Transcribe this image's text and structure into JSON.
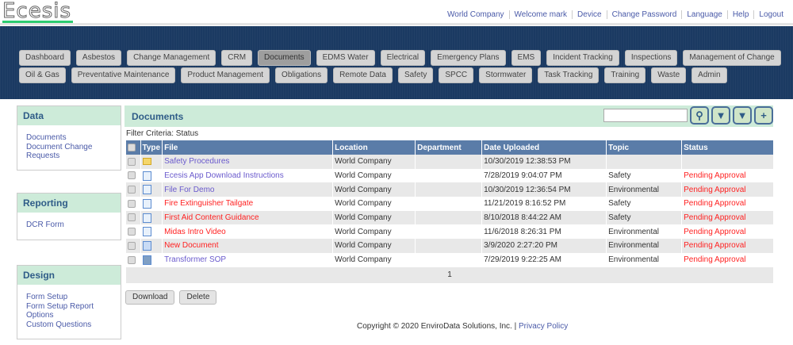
{
  "logo": "Ecesis",
  "top_links": [
    "World Company",
    "Welcome mark",
    "Device",
    "Change Password",
    "Language",
    "Help",
    "Logout"
  ],
  "nav_row1": [
    "Dashboard",
    "Asbestos",
    "Change Management",
    "CRM",
    "Documents",
    "EDMS Water",
    "Electrical",
    "Emergency Plans",
    "EMS",
    "Incident Tracking",
    "Inspections",
    "Management of Change"
  ],
  "nav_row2": [
    "Oil & Gas",
    "Preventative Maintenance",
    "Product Management",
    "Obligations",
    "Remote Data",
    "Safety",
    "SPCC",
    "Stormwater",
    "Task Tracking",
    "Training",
    "Waste",
    "Admin"
  ],
  "active_nav": "Documents",
  "sidebar": [
    {
      "title": "Data",
      "items": [
        "Documents",
        "Document Change Requests"
      ]
    },
    {
      "title": "Reporting",
      "items": [
        "DCR Form"
      ]
    },
    {
      "title": "Design",
      "items": [
        "Form Setup",
        "Form Setup Report",
        "Options",
        "Custom Questions"
      ]
    }
  ],
  "main": {
    "title": "Documents",
    "search_value": "",
    "filter_criteria": "Filter Criteria: Status",
    "columns": [
      "Type",
      "File",
      "Location",
      "Department",
      "Date Uploaded",
      "Topic",
      "Status"
    ],
    "rows": [
      {
        "type": "folder",
        "file": "Safety Procedures",
        "file_color": "link",
        "location": "World Company",
        "department": "",
        "date": "10/30/2019 12:38:53 PM",
        "topic": "",
        "status": ""
      },
      {
        "type": "document",
        "file": "Ecesis App Download Instructions",
        "file_color": "link",
        "location": "World Company",
        "department": "",
        "date": "7/28/2019 9:04:07 PM",
        "topic": "Safety",
        "status": "Pending Approval"
      },
      {
        "type": "document",
        "file": "File For Demo",
        "file_color": "link",
        "location": "World Company",
        "department": "",
        "date": "10/30/2019 12:36:54 PM",
        "topic": "Environmental",
        "status": "Pending Approval"
      },
      {
        "type": "document",
        "file": "Fire Extinguisher Tailgate",
        "file_color": "red",
        "location": "World Company",
        "department": "",
        "date": "11/21/2019 8:16:52 PM",
        "topic": "Safety",
        "status": "Pending Approval"
      },
      {
        "type": "document",
        "file": "First Aid Content Guidance",
        "file_color": "red",
        "location": "World Company",
        "department": "",
        "date": "8/10/2018 8:44:22 AM",
        "topic": "Safety",
        "status": "Pending Approval"
      },
      {
        "type": "document",
        "file": "Midas Intro Video",
        "file_color": "red",
        "location": "World Company",
        "department": "",
        "date": "11/6/2018 8:26:31 PM",
        "topic": "Environmental",
        "status": "Pending Approval"
      },
      {
        "type": "word",
        "file": "New Document",
        "file_color": "red",
        "location": "World Company",
        "department": "",
        "date": "3/9/2020 2:27:20 PM",
        "topic": "Environmental",
        "status": "Pending Approval"
      },
      {
        "type": "image",
        "file": "Transformer SOP",
        "file_color": "link",
        "location": "World Company",
        "department": "",
        "date": "7/29/2019 9:22:25 AM",
        "topic": "Environmental",
        "status": "Pending Approval"
      }
    ],
    "page": "1",
    "download_label": "Download",
    "delete_label": "Delete"
  },
  "footer": {
    "copyright": "Copyright © 2020 EnviroData Solutions, Inc. |",
    "privacy": "Privacy Policy"
  },
  "colors": {
    "nav_bg": "#1b3a62",
    "panel_header": "#cdebd9",
    "table_header": "#5a7ca8",
    "link": "#6a5acd",
    "alert": "#ff2222"
  }
}
